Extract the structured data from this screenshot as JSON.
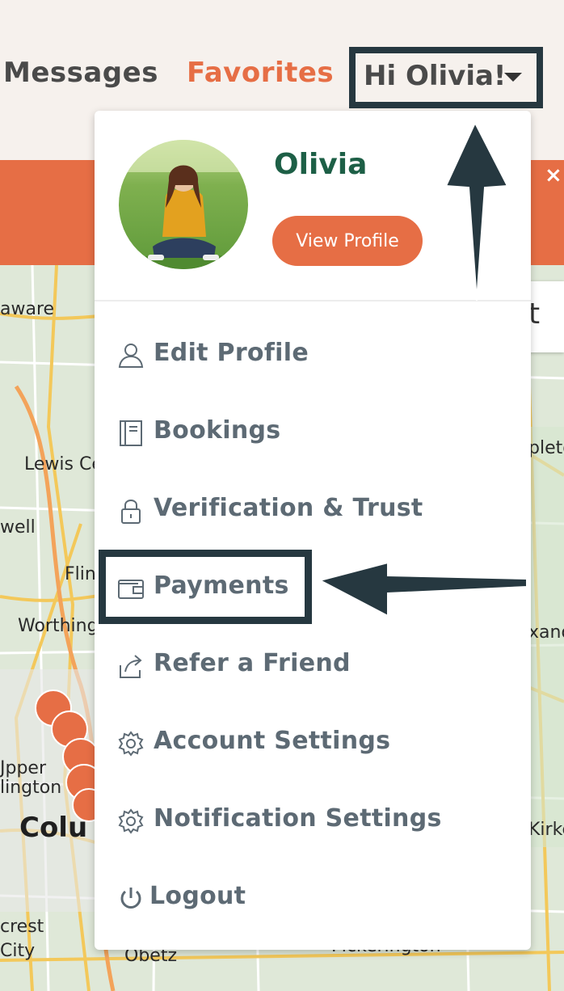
{
  "header": {
    "messages_label": "Messages",
    "favorites_label": "Favorites",
    "user_greeting": "Hi Olivia!"
  },
  "banner": {
    "close_icon": "×"
  },
  "map": {
    "labels": {
      "delaware": "aware",
      "lewis_center": "Lewis Ce",
      "powell": "well",
      "flint": "Flin",
      "worthington": "Worthing",
      "upper_arlington_1": "Jpper",
      "upper_arlington_2": "lington",
      "columbus": "Colu",
      "grove_city_1": "crest",
      "grove_city_2": "City",
      "obetz": "Obetz",
      "pickerington": "Pickerington",
      "right_1": "pleto",
      "right_2": "xand",
      "right_3": "Kirke"
    },
    "control_glyph": "t"
  },
  "profile": {
    "name": "Olivia",
    "view_profile_label": "View Profile"
  },
  "menu": {
    "items": [
      {
        "label": "Edit Profile",
        "icon": "user-icon"
      },
      {
        "label": "Bookings",
        "icon": "notebook-icon"
      },
      {
        "label": "Verification & Trust",
        "icon": "lock-icon"
      },
      {
        "label": "Payments",
        "icon": "wallet-icon"
      },
      {
        "label": "Refer a Friend",
        "icon": "share-icon"
      },
      {
        "label": "Account Settings",
        "icon": "gear-icon"
      },
      {
        "label": "Notification Settings",
        "icon": "gear-icon"
      },
      {
        "label": "Logout",
        "icon": "power-icon"
      }
    ]
  },
  "colors": {
    "accent": "#e66e45",
    "name_green": "#1d5f46",
    "menu_text": "#5d6a74",
    "annotation": "#263840"
  }
}
